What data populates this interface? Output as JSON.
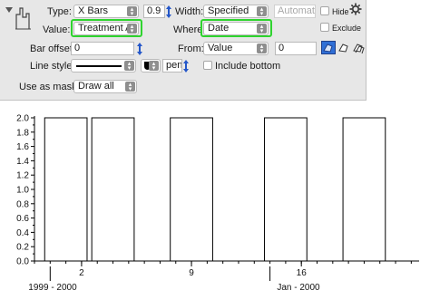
{
  "panel": {
    "type_label": "Type:",
    "type_value": "X Bars",
    "ratio_value": "0.9",
    "width_label": "Width:",
    "width_value": "Specified",
    "width_field": "Automatic",
    "hide_label": "Hide",
    "exclude_label": "Exclude",
    "value_label": "Value:",
    "value_value": "Treatment A",
    "where_label": "Where:",
    "where_value": "Date",
    "bar_offset_label": "Bar offset:",
    "bar_offset_value": "0",
    "from_label": "From:",
    "from_value": "Value",
    "from_field": "0",
    "line_style_label": "Line style:",
    "pen_label": "pen",
    "include_bottom_label": "Include bottom",
    "mask_label": "Use as mask:",
    "mask_value": "Draw all",
    "highlight_color": "#2fd42f"
  },
  "chart_data": {
    "type": "bar",
    "x_ticks": [
      "2",
      "9",
      "16"
    ],
    "x_subticks": [
      "1999 - 2000",
      "Jan - 2000"
    ],
    "y_ticks": [
      "0.0",
      "0.2",
      "0.4",
      "0.6",
      "0.8",
      "1.0",
      "1.2",
      "1.4",
      "1.6",
      "1.8",
      "2.0"
    ],
    "ylim": [
      0,
      2.0
    ],
    "xlim": [
      -1,
      23.5
    ],
    "x_tick_positions": [
      2,
      9,
      16
    ],
    "bars": [
      {
        "center": 1,
        "value": 2.0
      },
      {
        "center": 4,
        "value": 2.0
      },
      {
        "center": 9,
        "value": 2.0
      },
      {
        "center": 15,
        "value": 2.0
      },
      {
        "center": 20,
        "value": 2.0
      }
    ],
    "bar_width": 2.7
  }
}
